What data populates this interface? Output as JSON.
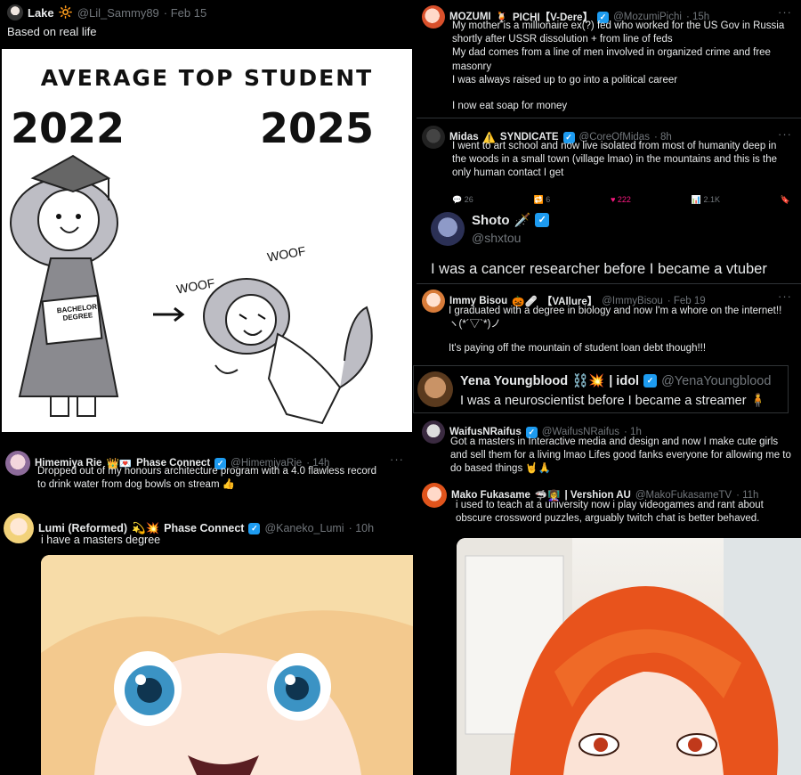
{
  "tweets": {
    "lake": {
      "name": "Lake",
      "emoji": "🔆",
      "handle": "@Lil_Sammy89",
      "date": "· Feb 15",
      "text": "Based on real life"
    },
    "comic": {
      "title": "AVERAGE TOP STUDENT",
      "year_left": "2022",
      "year_right": "2025",
      "diploma": "BACHELOR DEGREE",
      "woof1": "WOOF",
      "woof2": "WOOF"
    },
    "mozumi": {
      "name": "MOZUMI",
      "emoji": "🍹",
      "name2": "PICHI【V-Dere】",
      "handle": "@MozumiPichi",
      "date": "· 15h",
      "lines": [
        "My mother is a millionaire ex(?) fed who worked for the US Gov in Russia",
        "shortly after USSR dissolution + from line of feds",
        "My dad comes from a line of men involved in organized crime and free",
        "masonry",
        "I was always raised up to go into a political career",
        "I now eat soap for money"
      ]
    },
    "midas": {
      "name": "Midas",
      "emoji": "⚠️",
      "name2": "SYNDICATE",
      "handle": "@CoreOfMidas",
      "date": "· 8h",
      "lines": [
        "I went to art school and now live isolated from most of humanity deep in",
        "the woods in a small town (village lmao) in the mountains and this is the",
        "only human contact I get"
      ],
      "stats": {
        "replies": "26",
        "reposts": "6",
        "likes": "222",
        "views": "2.1K"
      }
    },
    "shoto": {
      "name": "Shoto",
      "emoji": "🗡️",
      "handle": "@shxtou",
      "text": "I was a cancer researcher before I became a vtuber"
    },
    "immy": {
      "name": "Immy Bisou",
      "emoji": "🎃🩹",
      "name2": "【VAllure】",
      "handle": "@ImmyBisou",
      "date": "· Feb 19",
      "lines": [
        "I graduated with a degree in biology and now I'm a whore on the internet!!",
        "ヽ(*´▽`*)ノ",
        "It's paying off the mountain of student loan debt though!!!"
      ]
    },
    "yena": {
      "name": "Yena Youngblood",
      "emoji": "⛓️💥",
      "name2": "| idol",
      "handle": "@YenaYoungblood",
      "text": "I was a neuroscientist before I became a streamer",
      "text_emoji": "🧍"
    },
    "waifus": {
      "name": "WaifusNRaifus",
      "handle": "@WaifusNRaifus",
      "date": "· 1h",
      "lines": [
        "Got a masters in Interactive media and design and now I make cute girls",
        "and sell them for a living lmao Lifes good fanks everyone for allowing me to",
        "do based things 🤘🙏"
      ]
    },
    "himemiya": {
      "name": "Himemiya Rie",
      "emoji": "👑💌",
      "name2": "Phase Connect",
      "handle": "@HimemiyaRie",
      "date": "· 14h",
      "lines": [
        "Dropped out of my honours architecture program with a 4.0 flawless record",
        "to drink water from dog bowls on stream 👍"
      ]
    },
    "mako": {
      "name": "Mako Fukasame",
      "emoji": "🦈👩‍🏫",
      "name2": "| Vershion AU",
      "handle": "@MakoFukasameTV",
      "date": "· 11h",
      "lines": [
        "i used to teach at a university now i play videogames and rant about",
        "obscure crossword puzzles, arguably twitch chat is better behaved."
      ]
    },
    "lumi": {
      "name": "Lumi (Reformed)",
      "emoji": "💫💥",
      "name2": "Phase Connect",
      "handle": "@Kaneko_Lumi",
      "date": "· 10h",
      "text": "i have a masters degree"
    }
  },
  "icons": {
    "more": "···",
    "verified": "✓"
  },
  "colors": {
    "bg": "#000000",
    "text": "#e7e9ea",
    "muted": "#71767b",
    "verified": "#1d9bf0",
    "like": "#f91880"
  }
}
